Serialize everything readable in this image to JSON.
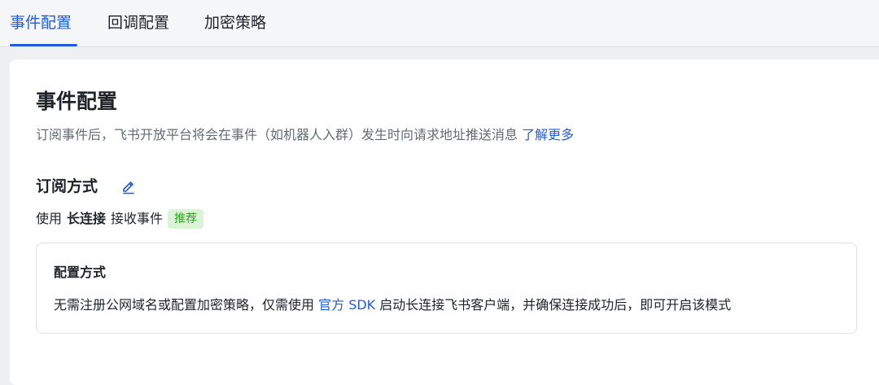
{
  "tabs": [
    {
      "label": "事件配置",
      "active": true
    },
    {
      "label": "回调配置",
      "active": false
    },
    {
      "label": "加密策略",
      "active": false
    }
  ],
  "page": {
    "title": "事件配置",
    "description": "订阅事件后，飞书开放平台将会在事件（如机器人入群）发生时向请求地址推送消息",
    "learn_more": "了解更多"
  },
  "subscription": {
    "heading": "订阅方式",
    "edit_icon": "pencil-icon",
    "prefix": "使用",
    "mode": "长连接",
    "suffix": "接收事件",
    "badge": "推荐"
  },
  "config": {
    "title": "配置方式",
    "desc_before": "无需注册公网域名或配置加密策略，仅需使用",
    "sdk_link": "官方 SDK",
    "desc_after": "启动长连接飞书客户端，并确保连接成功后，即可开启该模式"
  },
  "colors": {
    "accent": "#245bdb",
    "badge_bg": "#d9f5d6",
    "badge_text": "#2ea121"
  }
}
